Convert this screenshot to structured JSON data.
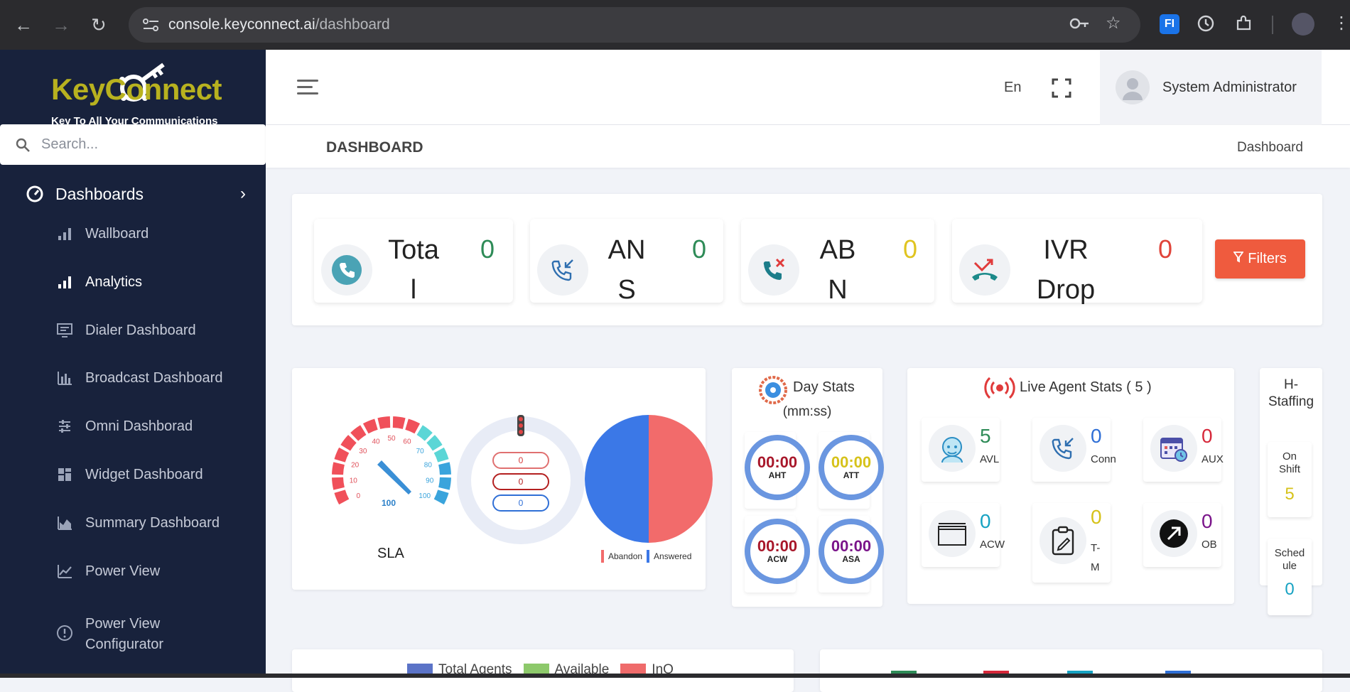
{
  "browser": {
    "url_host": "console.keyconnect.ai",
    "url_path": "/dashboard"
  },
  "sidebar": {
    "logo_text": "KeyConnect",
    "logo_tagline": "Key To All Your Communications",
    "search_placeholder": "Search...",
    "section_label": "Dashboards",
    "items": [
      {
        "label": "Wallboard",
        "icon": "bar-chart-icon"
      },
      {
        "label": "Analytics",
        "icon": "bar-chart-icon"
      },
      {
        "label": "Dialer Dashboard",
        "icon": "monitor-icon"
      },
      {
        "label": "Broadcast Dashboard",
        "icon": "column-chart-icon"
      },
      {
        "label": "Omni Dashborad",
        "icon": "sliders-icon"
      },
      {
        "label": "Widget Dashboard",
        "icon": "widgets-icon"
      },
      {
        "label": "Summary Dashboard",
        "icon": "area-chart-icon"
      },
      {
        "label": "Power View",
        "icon": "line-chart-icon"
      },
      {
        "label": "Power View Configurator",
        "icon": "info-circle-icon"
      }
    ],
    "active_item": "Analytics"
  },
  "header": {
    "language": "En",
    "user_name": "System Administrator"
  },
  "page": {
    "title": "DASHBOARD",
    "breadcrumb": "Dashboard"
  },
  "kpis": [
    {
      "label": "Total",
      "value": "0",
      "color": "#2e8b57"
    },
    {
      "label": "ANS",
      "value": "0",
      "color": "#2e8b57"
    },
    {
      "label": "ABN",
      "value": "0",
      "color": "#e0c420"
    },
    {
      "label": "IVR Drop",
      "value": "0",
      "color": "#e0443a"
    }
  ],
  "filters_label": "Filters",
  "sla": {
    "label": "SLA",
    "gauge_ticks": [
      "0",
      "10",
      "20",
      "30",
      "40",
      "50",
      "60",
      "70",
      "80",
      "90",
      "100"
    ],
    "gauge_value_text": "100",
    "queue_values": [
      "0",
      "0",
      "0"
    ],
    "legend": [
      "Abandon",
      "Answered"
    ],
    "pie_abandon_fraction": 0.5,
    "pie_answered_fraction": 0.5
  },
  "day_stats": {
    "title": "Day Stats",
    "subtitle": "(mm:ss)",
    "rings": [
      {
        "value": "00:00",
        "label": "AHT",
        "color": "#a8172a"
      },
      {
        "value": "00:00",
        "label": "ATT",
        "color": "#d6c21a"
      },
      {
        "value": "00:00",
        "label": "ACW",
        "color": "#a8172a"
      },
      {
        "value": "00:00",
        "label": "ASA",
        "color": "#7a148a"
      }
    ]
  },
  "live_agent": {
    "title": "Live Agent Stats ( 5 )",
    "tiles": [
      {
        "value": "5",
        "label": "AVL",
        "color": "#2e8b57",
        "icon": "agent-face-icon"
      },
      {
        "value": "0",
        "label": "Conn",
        "color": "#2f6fd6",
        "icon": "incoming-call-icon"
      },
      {
        "value": "0",
        "label": "AUX",
        "color": "#d6283a",
        "icon": "calendar-clock-icon"
      },
      {
        "value": "0",
        "label": "ACW",
        "color": "#17a2c2",
        "icon": "window-icon"
      },
      {
        "value": "0",
        "label": "T-M",
        "color": "#d6c21a",
        "icon": "clipboard-icon"
      },
      {
        "value": "0",
        "label": "OB",
        "color": "#7a148a",
        "icon": "outbound-arrow-icon"
      }
    ]
  },
  "h_staffing": {
    "title": "H-Staffing",
    "on_shift_label": "On Shift",
    "on_shift_value": "5",
    "schedule_label": "Schedule",
    "schedule_value": "0"
  },
  "bottom_legend": [
    "Total Agents",
    "Available",
    "InQ"
  ]
}
